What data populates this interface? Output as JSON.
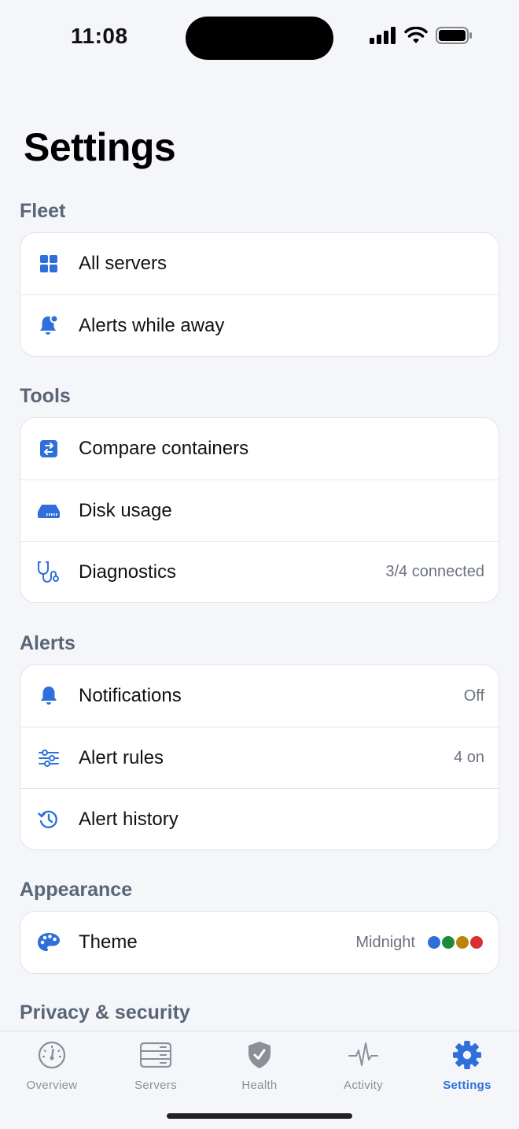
{
  "status_bar": {
    "time": "11:08"
  },
  "title": "Settings",
  "colors": {
    "accent": "#2f6fdc",
    "muted": "#8a8f98"
  },
  "sections": {
    "fleet": {
      "header": "Fleet",
      "items": [
        {
          "label": "All servers",
          "icon": "grid-icon"
        },
        {
          "label": "Alerts while away",
          "icon": "bell-badge-icon"
        }
      ]
    },
    "tools": {
      "header": "Tools",
      "items": [
        {
          "label": "Compare containers",
          "icon": "compare-icon"
        },
        {
          "label": "Disk usage",
          "icon": "drive-icon"
        },
        {
          "label": "Diagnostics",
          "icon": "stethoscope-icon",
          "value": "3/4 connected"
        }
      ]
    },
    "alerts": {
      "header": "Alerts",
      "items": [
        {
          "label": "Notifications",
          "icon": "bell-icon",
          "value": "Off"
        },
        {
          "label": "Alert rules",
          "icon": "sliders-icon",
          "value": "4 on"
        },
        {
          "label": "Alert history",
          "icon": "history-icon"
        }
      ]
    },
    "appearance": {
      "header": "Appearance",
      "items": [
        {
          "label": "Theme",
          "icon": "palette-icon",
          "value": "Midnight",
          "swatches": [
            "#2f6fdc",
            "#1e8a3a",
            "#b8860b",
            "#d93036"
          ]
        }
      ]
    },
    "privacy": {
      "header": "Privacy & security"
    }
  },
  "tab_bar": {
    "tabs": [
      {
        "label": "Overview",
        "icon": "gauge-icon"
      },
      {
        "label": "Servers",
        "icon": "server-rack-icon"
      },
      {
        "label": "Health",
        "icon": "shield-check-icon"
      },
      {
        "label": "Activity",
        "icon": "waveform-icon"
      },
      {
        "label": "Settings",
        "icon": "gear-icon",
        "active": true
      }
    ]
  }
}
